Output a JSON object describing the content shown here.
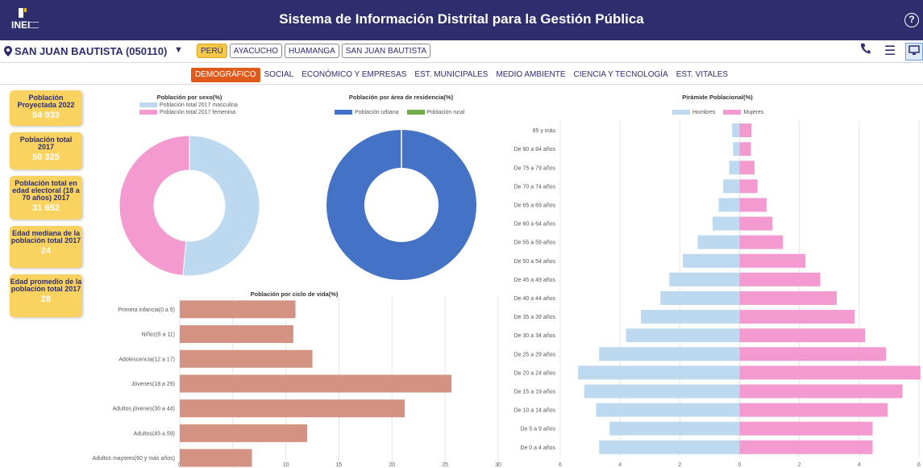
{
  "header": {
    "title": "Sistema de Información Distrital para la Gestión Pública",
    "logo_text": "INEI",
    "help": "?"
  },
  "toolbar": {
    "location": "SAN JUAN BAUTISTA (050110)",
    "breadcrumbs": [
      "PERÚ",
      "AYACUCHO",
      "HUAMANGA",
      "SAN JUAN BAUTISTA"
    ],
    "icons": [
      "phone-icon",
      "list-icon",
      "screen-icon"
    ]
  },
  "tabs": [
    "DEMOGRÁFICO",
    "SOCIAL",
    "ECONÓMICO Y EMPRESAS",
    "EST. MUNICIPALES",
    "MEDIO AMBIENTE",
    "CIENCIA Y TECNOLOGÍA",
    "EST. VITALES"
  ],
  "kpis": [
    {
      "label": "Población Proyectada 2022",
      "value": "54 933"
    },
    {
      "label": "Población total 2017",
      "value": "50 325"
    },
    {
      "label": "Población total en edad electoral (18 a 70 años) 2017",
      "value": "31 652"
    },
    {
      "label": "Edad mediana de la población total 2017",
      "value": "24"
    },
    {
      "label": "Edad promedio de la población total 2017",
      "value": "28"
    }
  ],
  "colors": {
    "header": "#2e2e6e",
    "accent": "#e05a1c",
    "kpi": "#f9d25f",
    "male": "#bcd9ef",
    "female": "#f39bd0",
    "urban": "#4472c4",
    "rural": "#70ad47",
    "bar": "#d49283"
  },
  "chart_data": [
    {
      "type": "pie",
      "title": "Población por sexo(%)",
      "labels": [
        "Población total 2017 masculina",
        "Población total 2017 femenina"
      ],
      "values": [
        51.5,
        48.5
      ]
    },
    {
      "type": "pie",
      "title": "Población por área de residencia(%)",
      "labels": [
        "Población urbana",
        "Población rural"
      ],
      "values": [
        100,
        0
      ]
    },
    {
      "type": "bar",
      "title": "Población por ciclo de vida(%)",
      "categories": [
        "Primera infancia(0 a 5)",
        "Niñez(6 a 11)",
        "Adolescencia(12 a 17)",
        "Jóvenes(18 a 29)",
        "Adultos jóvenes(30 a 44)",
        "Adultos(45 a 59)",
        "Adultos mayores(60 y más años)"
      ],
      "values": [
        10.9,
        10.7,
        12.5,
        25.6,
        21.2,
        12.0,
        6.8
      ],
      "xlim": [
        0,
        30
      ],
      "xticks": [
        "0",
        "5",
        "10",
        "15",
        "20",
        "25",
        "30"
      ]
    },
    {
      "type": "bar",
      "title": "Pirámide Poblacional(%)",
      "categories": [
        "85 y más",
        "De 80 a 84 años",
        "De 75 a 79 años",
        "De 70 a 74 años",
        "De 65 a 69 años",
        "De 60 a 64 años",
        "De 55 a 59 años",
        "De 50 a 54 años",
        "De 45 a 49 años",
        "De 40 a 44 años",
        "De 35 a 39 años",
        "De 30 a 34 años",
        "De 25 a 29 años",
        "De 20 a 24 años",
        "De 15 a 19 años",
        "De 10 a 14 años",
        "De 5 a 9 años",
        "De 0 a 4 años"
      ],
      "series": [
        {
          "name": "Hombres",
          "values": [
            0.25,
            0.22,
            0.35,
            0.55,
            0.7,
            0.9,
            1.4,
            1.9,
            2.35,
            2.65,
            3.3,
            3.8,
            4.7,
            5.4,
            5.2,
            4.8,
            4.35,
            4.7
          ]
        },
        {
          "name": "Mujeres",
          "values": [
            0.4,
            0.38,
            0.5,
            0.6,
            0.9,
            1.1,
            1.45,
            2.2,
            2.7,
            3.25,
            3.85,
            4.2,
            4.9,
            6.05,
            5.45,
            4.95,
            4.45,
            4.45
          ]
        }
      ],
      "xlim": [
        -6,
        6
      ],
      "xticks": [
        "6",
        "4",
        "2",
        "0",
        "2",
        "4",
        "6"
      ]
    }
  ]
}
